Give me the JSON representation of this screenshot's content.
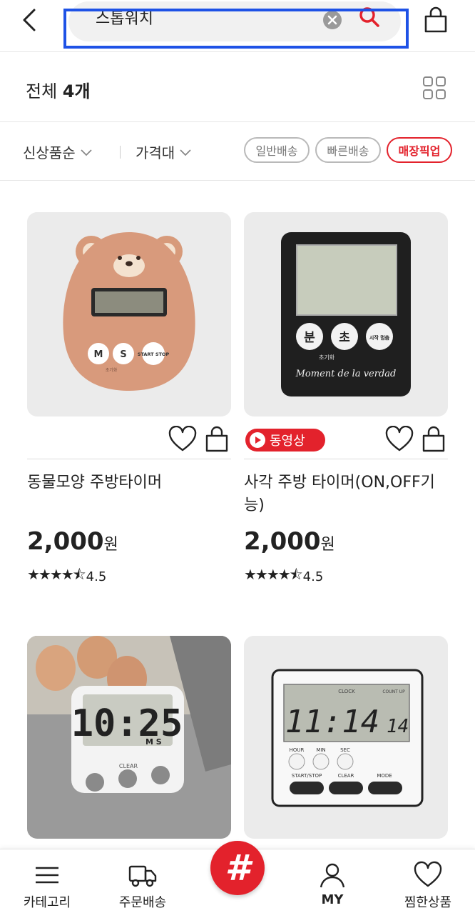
{
  "header": {
    "search_query": "스톱워치"
  },
  "results": {
    "count_prefix": "전체 ",
    "count_value": "4개"
  },
  "filters": {
    "sort_label": "신상품순",
    "price_label": "가격대",
    "delivery_options": [
      "일반배송",
      "빠른배송",
      "매장픽업"
    ],
    "active_option": "매장픽업"
  },
  "products": [
    {
      "name": "동물모양 주방타이머",
      "price": "2,000",
      "currency": "원",
      "rating": "4.5",
      "rating_value": 4.5,
      "has_video": false
    },
    {
      "name": "사각 주방 타이머(ON,OFF기능)",
      "price": "2,000",
      "currency": "원",
      "rating": "4.5",
      "rating_value": 4.5,
      "has_video": true,
      "video_label": "동영상"
    }
  ],
  "product_images": {
    "bear_buttons": [
      "M",
      "S",
      "START STOP"
    ],
    "bear_sub": "초기화",
    "square_buttons": [
      "분",
      "초",
      "시작 멈춤"
    ],
    "square_sub": "초기화",
    "square_script": "Moment de la verdad",
    "white_timer_display": "10:25",
    "white_timer_units": "M  S",
    "white_timer_clear": "CLEAR",
    "clock_title": "CLOCK",
    "clock_countup": "COUNT UP",
    "clock_display": "11:14",
    "clock_seconds": "14",
    "clock_buttons_top": [
      "HOUR",
      "MIN",
      "SEC"
    ],
    "clock_buttons_bottom": [
      "START/STOP",
      "CLEAR",
      "MODE"
    ]
  },
  "bottom_nav": {
    "category": "카테고리",
    "orders": "주문배송",
    "center": "#",
    "my": "MY",
    "wishlist": "찜한상품"
  },
  "colors": {
    "accent": "#e3222c",
    "highlight": "#1e52e6"
  }
}
